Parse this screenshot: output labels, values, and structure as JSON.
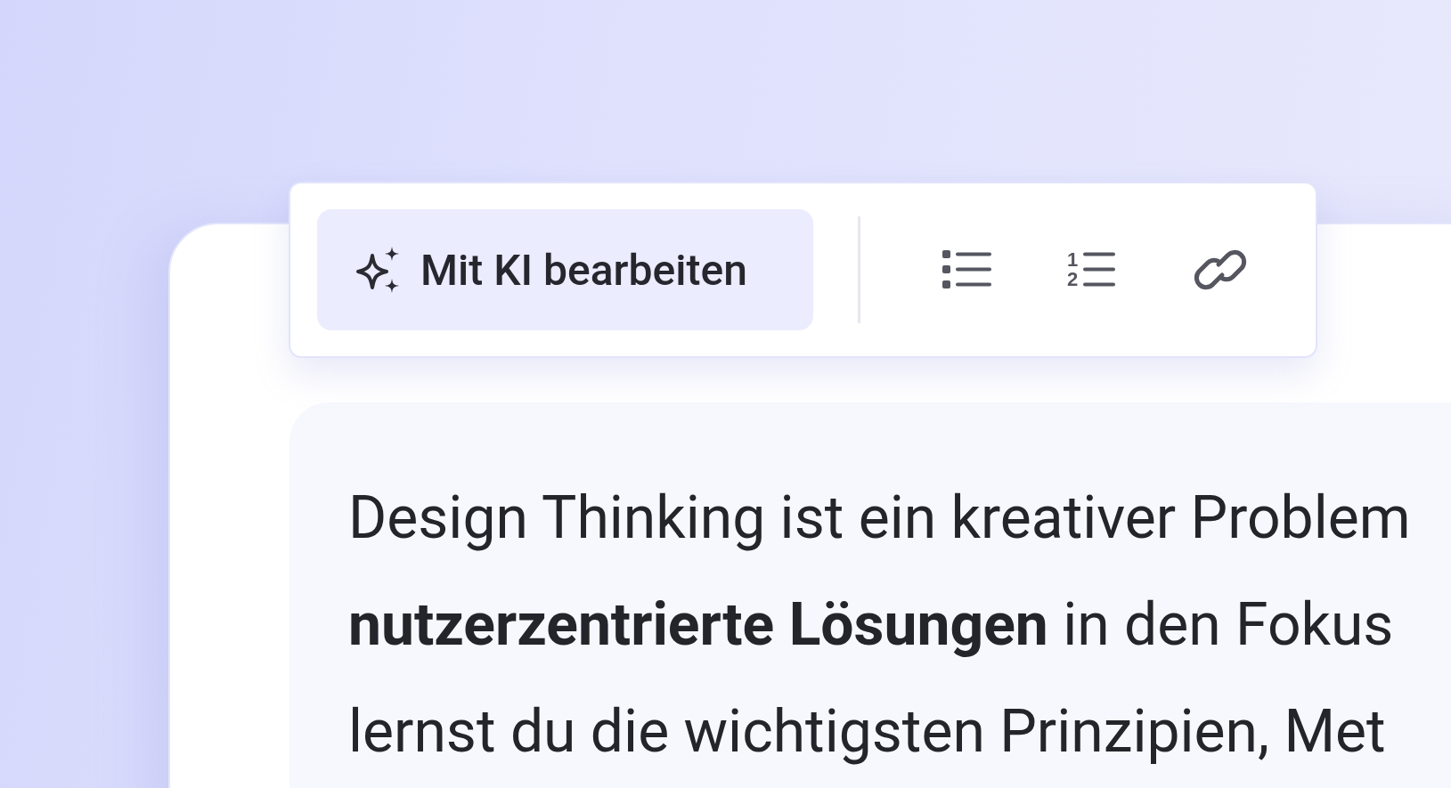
{
  "toolbar": {
    "ai_button": {
      "label": "Mit KI bearbeiten"
    },
    "tools": [
      {
        "kind": "bullet-list"
      },
      {
        "kind": "numbered-list",
        "marks": [
          "1",
          "2"
        ]
      },
      {
        "kind": "link"
      }
    ]
  },
  "content": {
    "lines": [
      "Design Thinking ist ein kreativer Problem",
      "**nutzerzentrierte Lösungen** in den Fokus",
      "lernst du die wichtigsten Prinzipien, Met"
    ]
  }
}
